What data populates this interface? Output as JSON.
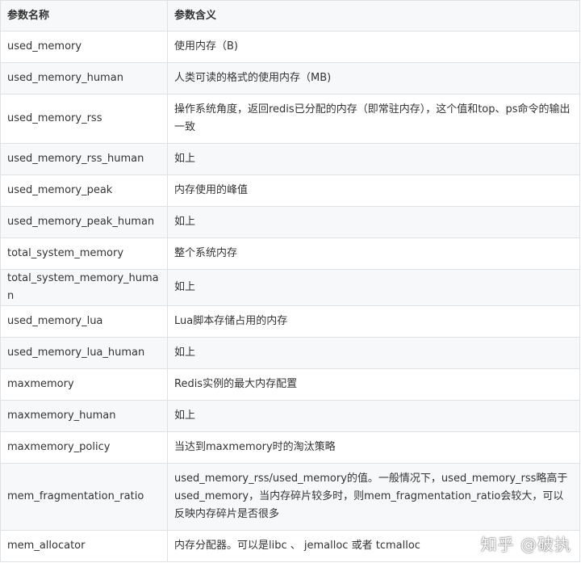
{
  "header": {
    "col1": "参数名称",
    "col2": "参数含义"
  },
  "rows": [
    {
      "name": "used_memory",
      "desc": "使用内存（B)"
    },
    {
      "name": "used_memory_human",
      "desc": "人类可读的格式的使用内存（MB)"
    },
    {
      "name": "used_memory_rss",
      "desc": "操作系统角度，返回redis已分配的内存（即常驻内存），这个值和top、ps命令的输出一致"
    },
    {
      "name": "used_memory_rss_human",
      "desc": "如上"
    },
    {
      "name": "used_memory_peak",
      "desc": "内存使用的峰值"
    },
    {
      "name": "used_memory_peak_human",
      "desc": "如上"
    },
    {
      "name": "total_system_memory",
      "desc": "整个系统内存"
    },
    {
      "name": "total_system_memory_human",
      "desc": "如上"
    },
    {
      "name": "used_memory_lua",
      "desc": "Lua脚本存储占用的内存"
    },
    {
      "name": "used_memory_lua_human",
      "desc": "如上"
    },
    {
      "name": "maxmemory",
      "desc": "Redis实例的最大内存配置"
    },
    {
      "name": "maxmemory_human",
      "desc": "如上"
    },
    {
      "name": "maxmemory_policy",
      "desc": "当达到maxmemory时的淘汰策略"
    },
    {
      "name": "mem_fragmentation_ratio",
      "desc": "used_memory_rss/used_memory的值。一般情况下，used_memory_rss略高于used_memory，当内存碎片较多时，则mem_fragmentation_ratio会较大，可以反映内存碎片是否很多"
    },
    {
      "name": "mem_allocator",
      "desc": "内存分配器。可以是libc 、 jemalloc 或者 tcmalloc"
    }
  ],
  "watermark": "知乎 @破执"
}
